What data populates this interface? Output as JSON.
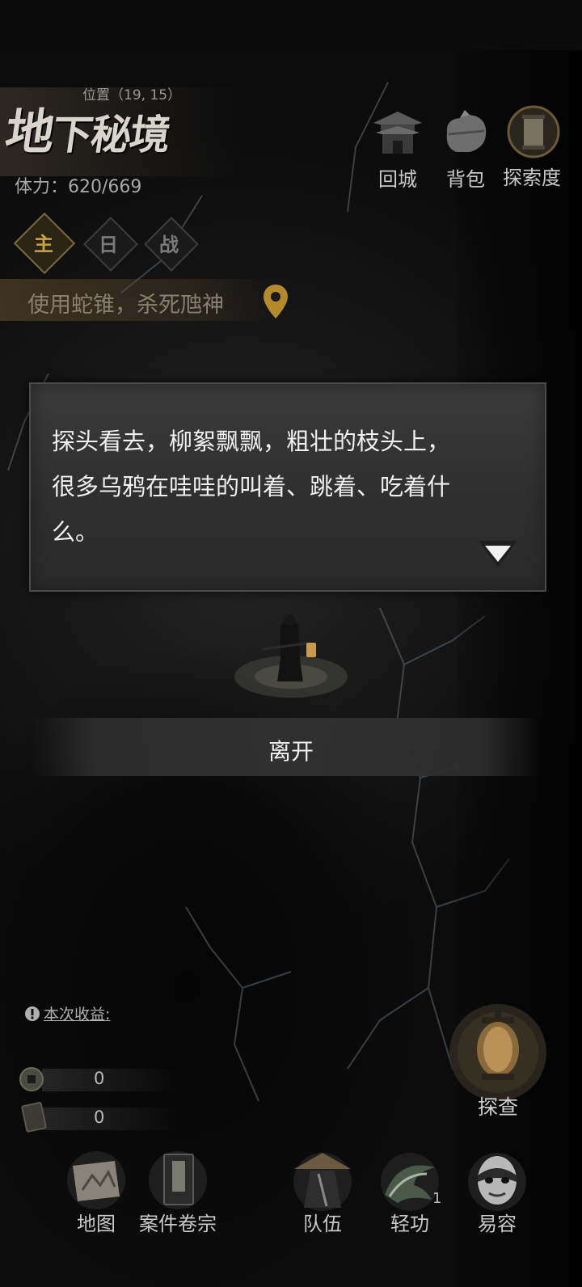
{
  "header": {
    "title_big": "地",
    "title_rest": "下秘境",
    "position": "位置（19, 15）",
    "stamina": "体力：620/669"
  },
  "top_buttons": [
    {
      "label": "回城",
      "icon": "city-gate-icon"
    },
    {
      "label": "背包",
      "icon": "bundle-icon"
    },
    {
      "label": "探索度",
      "icon": "scroll-icon"
    }
  ],
  "tabs": [
    {
      "label": "主",
      "active": true
    },
    {
      "label": "日",
      "active": false
    },
    {
      "label": "战",
      "active": false
    }
  ],
  "quest": {
    "text": "使用蛇锥，杀死虺神",
    "icon": "location-pin-icon"
  },
  "dialog": {
    "lines": [
      "探头看去，柳絮飘飘，粗壮的枝头上，",
      "很多乌鸦在哇哇的叫着、跳着、吃着什",
      "么。"
    ]
  },
  "leave": {
    "label": "离开"
  },
  "gains": {
    "title": "本次收益:",
    "rows": [
      {
        "icon": "coin-icon",
        "value": "0"
      },
      {
        "icon": "token-card-icon",
        "value": "0"
      }
    ]
  },
  "explore": {
    "label": "探查",
    "icon": "lantern-icon"
  },
  "bottom_nav": [
    {
      "label": "地图",
      "icon": "map-scroll-icon"
    },
    {
      "label": "案件卷宗",
      "icon": "case-file-icon"
    },
    {
      "label": "队伍",
      "icon": "party-straw-hat-icon"
    },
    {
      "label": "轻功",
      "icon": "lightness-skill-icon",
      "badge": "1"
    },
    {
      "label": "易容",
      "icon": "disguise-mask-icon"
    }
  ],
  "colors": {
    "accent_gold": "#c9a24a",
    "panel": "#333333",
    "text": "#f0f0f0"
  }
}
